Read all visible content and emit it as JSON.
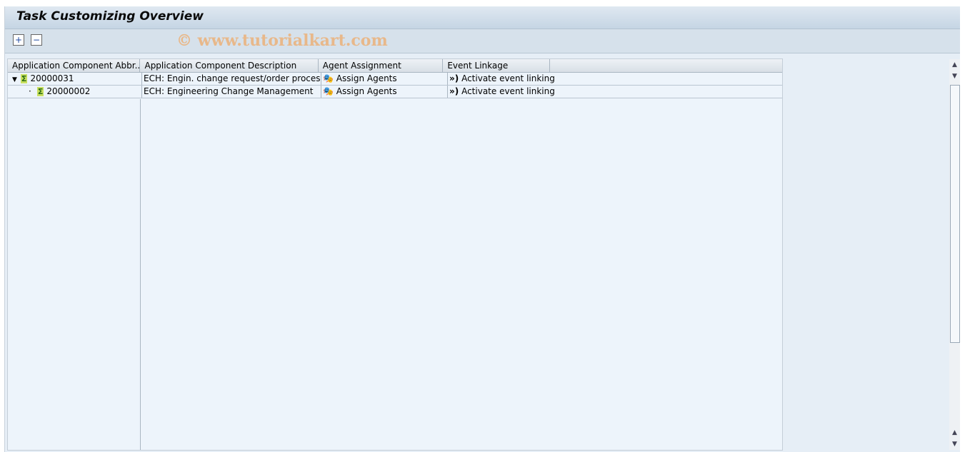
{
  "title": "Task Customizing Overview",
  "watermark": "© www.tutorialkart.com",
  "toolbar": {
    "expand": "expand-subtree-icon",
    "collapse": "collapse-subtree-icon"
  },
  "columns": [
    "Application Component Abbr...",
    "Application Component Description",
    "Agent Assignment",
    "Event Linkage"
  ],
  "rows": [
    {
      "id": "20000031",
      "desc": "ECH: Engin. change request/order process",
      "agent": "Assign Agents",
      "event": "Activate event linking",
      "expanded": true,
      "level": 0
    },
    {
      "id": "20000002",
      "desc": "ECH: Engineering Change Management",
      "agent": "Assign Agents",
      "event": "Activate event linking",
      "level": 1
    }
  ]
}
